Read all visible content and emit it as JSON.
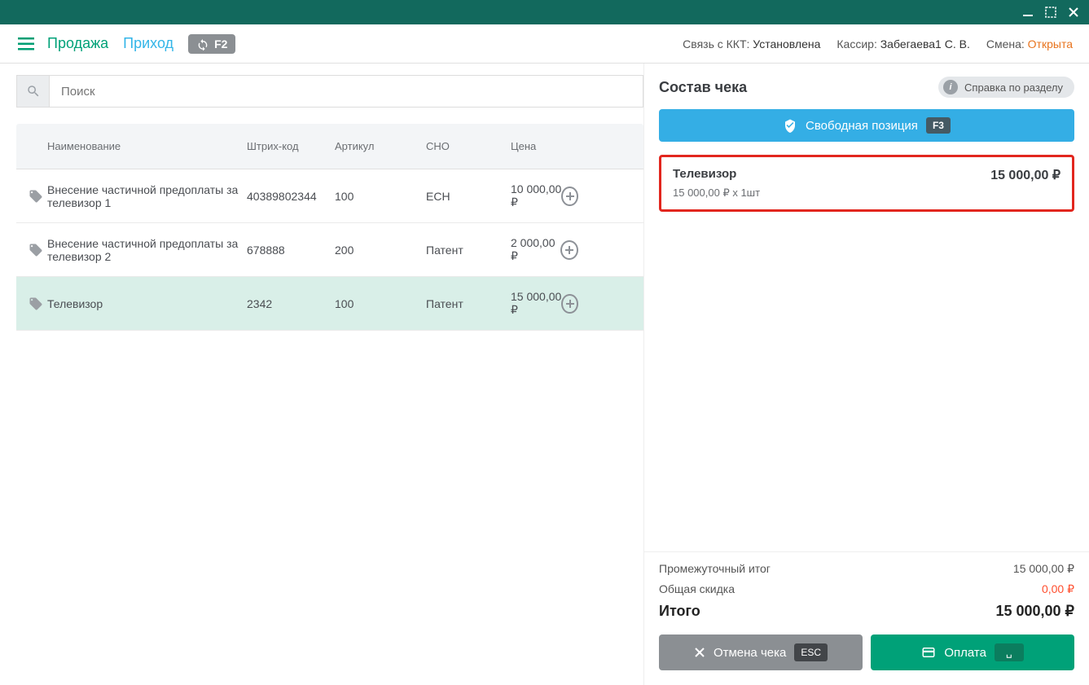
{
  "header": {
    "tab_sale": "Продажа",
    "tab_income": "Приход",
    "f2_label": "F2",
    "status_kkt_label": "Связь с ККТ:",
    "status_kkt_value": "Установлена",
    "status_cashier_label": "Кассир:",
    "status_cashier_value": "Забегаева1 С. В.",
    "status_shift_label": "Смена:",
    "status_shift_value": "Открыта"
  },
  "search": {
    "placeholder": "Поиск"
  },
  "table": {
    "headers": {
      "name": "Наименование",
      "barcode": "Штрих-код",
      "article": "Артикул",
      "sno": "СНО",
      "price": "Цена"
    },
    "rows": [
      {
        "name": "Внесение частичной предоплаты за телевизор 1",
        "barcode": "40389802344",
        "article": "100",
        "sno": "ЕСН",
        "price": "10 000,00 ₽",
        "selected": false
      },
      {
        "name": "Внесение частичной предоплаты за телевизор 2",
        "barcode": "678888",
        "article": "200",
        "sno": "Патент",
        "price": "2 000,00 ₽",
        "selected": false
      },
      {
        "name": "Телевизор",
        "barcode": "2342",
        "article": "100",
        "sno": "Патент",
        "price": "15 000,00 ₽",
        "selected": true
      }
    ]
  },
  "receipt": {
    "title": "Состав чека",
    "help_label": "Справка по разделу",
    "free_pos_label": "Свободная позиция",
    "free_pos_key": "F3",
    "items": [
      {
        "name": "Телевизор",
        "sub": "15 000,00 ₽ х 1шт",
        "total": "15 000,00 ₽"
      }
    ],
    "subtotal_label": "Промежуточный итог",
    "subtotal_value": "15 000,00 ₽",
    "discount_label": "Общая скидка",
    "discount_value": "0,00 ₽",
    "grand_label": "Итого",
    "grand_value": "15 000,00 ₽",
    "cancel_label": "Отмена чека",
    "cancel_key": "ESC",
    "pay_label": "Оплата",
    "pay_key": "␣"
  }
}
